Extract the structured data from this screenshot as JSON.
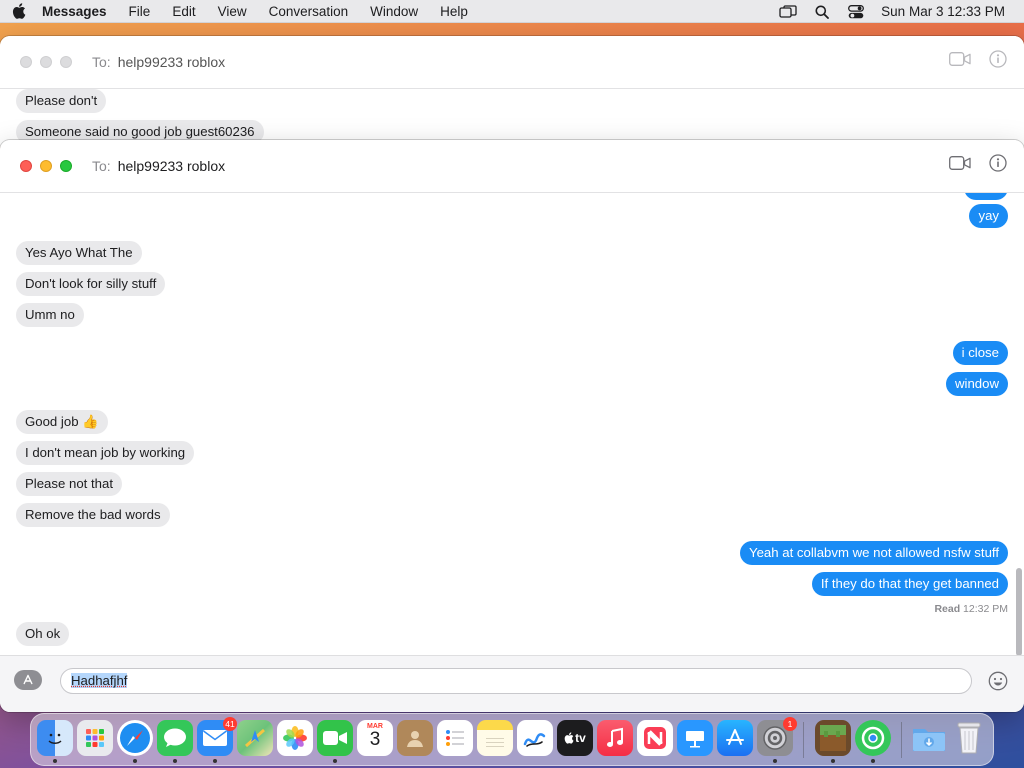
{
  "menubar": {
    "app_name": "Messages",
    "items": [
      "File",
      "Edit",
      "View",
      "Conversation",
      "Window",
      "Help"
    ],
    "clock": "Sun Mar 3  12:33 PM"
  },
  "back_window": {
    "to_label": "To:",
    "recipient": "help99233 roblox",
    "messages": [
      {
        "text": "Please don't",
        "direction": "in"
      },
      {
        "text": "Someone said no good job guest60236",
        "direction": "in"
      }
    ]
  },
  "front_window": {
    "to_label": "To:",
    "recipient": "help99233 roblox",
    "messages": [
      {
        "text": "yay",
        "direction": "out"
      },
      {
        "text": "Yes Ayo What The",
        "direction": "in"
      },
      {
        "text": "Don't look for silly stuff",
        "direction": "in"
      },
      {
        "text": "Umm no",
        "direction": "in"
      },
      {
        "text": "i close",
        "direction": "out"
      },
      {
        "text": "window",
        "direction": "out"
      },
      {
        "text": "Good job 👍",
        "direction": "in"
      },
      {
        "text": "I don't mean job by working",
        "direction": "in"
      },
      {
        "text": "Please not that",
        "direction": "in"
      },
      {
        "text": "Remove the bad words",
        "direction": "in"
      },
      {
        "text": "Yeah at collabvm we not allowed nsfw stuff",
        "direction": "out"
      },
      {
        "text": "If they do that they get banned",
        "direction": "out"
      },
      {
        "text": "Oh ok",
        "direction": "in"
      }
    ],
    "read_receipt": {
      "label": "Read",
      "time": "12:32 PM"
    },
    "compose_value": "Hadhafjhf"
  },
  "dock": {
    "apps": [
      {
        "name": "Finder",
        "icon": "finder-icon",
        "color": "#3d8cf0",
        "running": true
      },
      {
        "name": "Launchpad",
        "icon": "launchpad-icon",
        "color": "#e9eaee",
        "running": false
      },
      {
        "name": "Safari",
        "icon": "safari-icon",
        "color": "#1f8ef1",
        "running": true
      },
      {
        "name": "Messages",
        "icon": "messages-icon",
        "color": "#34c759",
        "running": true
      },
      {
        "name": "Mail",
        "icon": "mail-icon",
        "color": "#2f8cf5",
        "running": true,
        "badge": "41"
      },
      {
        "name": "Maps",
        "icon": "maps-icon",
        "color": "#6cc27a",
        "running": false
      },
      {
        "name": "Photos",
        "icon": "photos-icon",
        "color": "#ffffff",
        "running": false
      },
      {
        "name": "FaceTime",
        "icon": "facetime-icon",
        "color": "#32c34a",
        "running": true
      },
      {
        "name": "Calendar",
        "icon": "calendar-icon",
        "color": "#ffffff",
        "running": false,
        "month": "MAR",
        "day": "3"
      },
      {
        "name": "Contacts",
        "icon": "contacts-icon",
        "color": "#b0885a",
        "running": false
      },
      {
        "name": "Reminders",
        "icon": "reminders-icon",
        "color": "#ffffff",
        "running": false
      },
      {
        "name": "Notes",
        "icon": "notes-icon",
        "color": "#fcd94a",
        "running": false
      },
      {
        "name": "Freeform",
        "icon": "freeform-icon",
        "color": "#ffffff",
        "running": false
      },
      {
        "name": "TV",
        "icon": "tv-icon",
        "color": "#1c1c1e",
        "running": false,
        "label": "tv"
      },
      {
        "name": "Music",
        "icon": "music-icon",
        "color": "#fa3d55",
        "running": false
      },
      {
        "name": "News",
        "icon": "news-icon",
        "color": "#ffffff",
        "running": false
      },
      {
        "name": "Keynote",
        "icon": "keynote-icon",
        "color": "#2997ff",
        "running": false
      },
      {
        "name": "App Store",
        "icon": "app-store-icon",
        "color": "#1b8cf7",
        "running": false
      },
      {
        "name": "System Settings",
        "icon": "settings-icon",
        "color": "#8e8e93",
        "running": true,
        "badge": "1"
      },
      {
        "name": "Minecraft",
        "icon": "minecraft-icon",
        "color": "#6aa84f",
        "running": true
      },
      {
        "name": "Find My",
        "icon": "find-my-icon",
        "color": "#34c759",
        "running": true
      },
      {
        "name": "Downloads",
        "icon": "downloads-folder-icon",
        "color": "#62a8ea",
        "running": false
      },
      {
        "name": "Trash",
        "icon": "trash-icon",
        "color": "#e5e5ea",
        "running": false
      }
    ]
  }
}
